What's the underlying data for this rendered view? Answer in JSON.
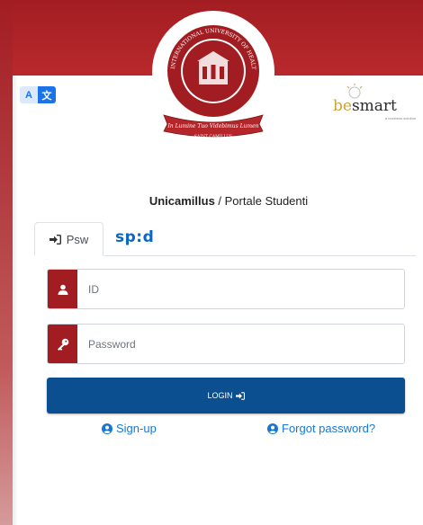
{
  "brand": {
    "seal_ring_text": "INTERNATIONAL UNIVERSITY OF HEALTH SCIENCES",
    "seal_motto": "In Lumine Tuo Videbimus Lumen",
    "seal_bottom": "SAINT CAMILLUS",
    "partner_be": "be",
    "partner_smart": "smart",
    "partner_tagline": "a business solution"
  },
  "translate": {
    "a": "A",
    "b": "文"
  },
  "title": {
    "institution": "Unicamillus",
    "separator": " / ",
    "portal": "Portale Studenti"
  },
  "tabs": {
    "psw": "Psw",
    "spid": "sp:d"
  },
  "form": {
    "id_placeholder": "ID",
    "password_placeholder": "Password",
    "login_label": "LOGIN"
  },
  "links": {
    "signup": "Sign-up",
    "forgot": "Forgot password?"
  },
  "colors": {
    "brand_red": "#a21d22",
    "login_blue": "#0b4f91",
    "link_blue": "#1877d6",
    "spid_blue": "#0b66c2"
  },
  "icons": [
    "translate-icon",
    "sign-in-icon",
    "user-icon",
    "key-icon",
    "user-circle-icon"
  ]
}
